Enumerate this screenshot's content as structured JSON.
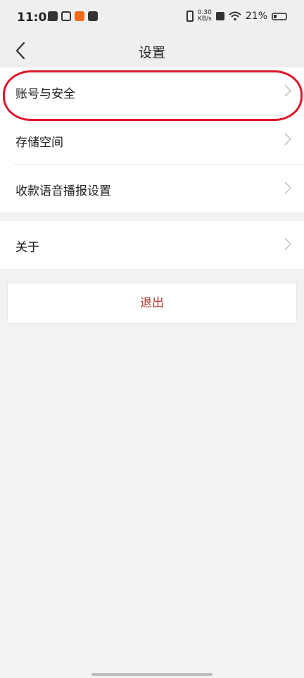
{
  "status_bar": {
    "time": "11:05",
    "net_speed_value": "0.30",
    "net_speed_unit": "KB/s",
    "battery_percent": "21%"
  },
  "header": {
    "title": "设置"
  },
  "settings": {
    "items": [
      {
        "label": "账号与安全"
      },
      {
        "label": "存储空间"
      },
      {
        "label": "收款语音播报设置"
      },
      {
        "label": "关于"
      }
    ]
  },
  "logout": {
    "label": "退出"
  },
  "colors": {
    "background": "#f2f2f2",
    "card": "#ffffff",
    "logout_text": "#b23a33",
    "highlight": "#e0162b"
  },
  "icons": {
    "back": "chevron-left-icon",
    "row_arrow": "chevron-right-icon"
  }
}
